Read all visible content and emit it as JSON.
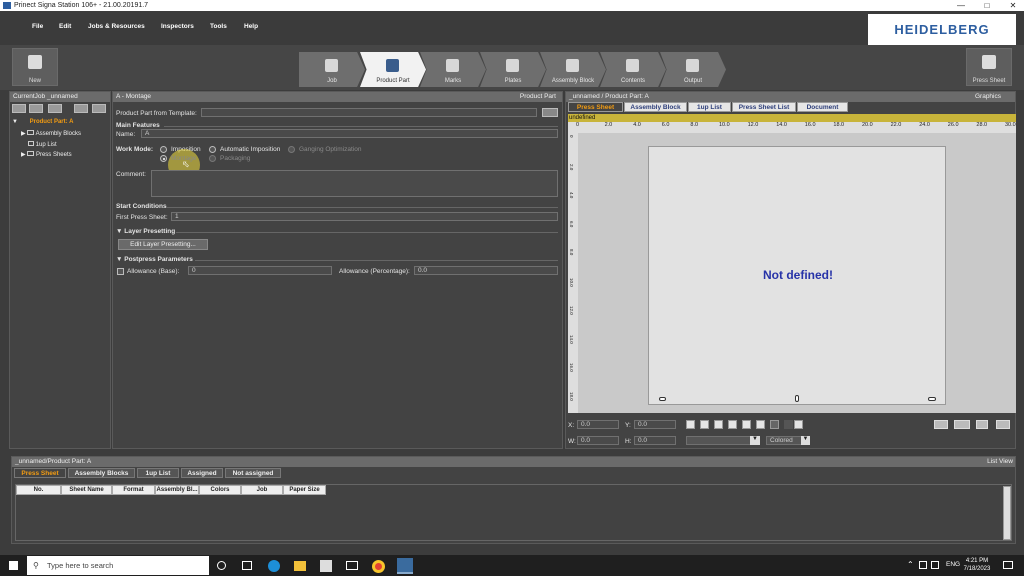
{
  "window": {
    "title": "Prinect Signa Station 106+  -  21.00.20191.7"
  },
  "menu": [
    "File",
    "Edit",
    "Jobs & Resources",
    "Inspectors",
    "Tools",
    "Help"
  ],
  "brand": "HEIDELBERG",
  "toolbar": {
    "new_label": "New",
    "press_sheet_label": "Press Sheet",
    "workflow": [
      "Job",
      "Product Part",
      "Marks",
      "Plates",
      "Assembly Block",
      "Contents",
      "Output"
    ],
    "active_step": "Product Part"
  },
  "left_panel": {
    "title": "CurrentJob _unnamed",
    "tree": {
      "root": "Product Part: A",
      "children": [
        "Assembly Blocks",
        "1up List",
        "Press Sheets"
      ]
    }
  },
  "montage": {
    "title": "A - Montage",
    "title_right": "Product Part",
    "template_label": "Product Part from Template:",
    "main_features": "Main Features",
    "name_label": "Name:",
    "name_value": "A",
    "work_mode_label": "Work Mode:",
    "modes": {
      "imposition": "Imposition",
      "automatic": "Automatic Imposition",
      "ganging": "Ganging Optimization",
      "montage": "Montage",
      "packaging": "Packaging"
    },
    "selected_mode": "Montage",
    "comment_label": "Comment:",
    "start_conditions": "Start Conditions",
    "first_press_sheet_label": "First Press Sheet:",
    "first_press_sheet_value": "1",
    "layer_presetting": "Layer Presetting",
    "edit_layer_button": "Edit Layer Presetting...",
    "postpress": "Postpress Parameters",
    "allowance_base_label": "Allowance (Base):",
    "allowance_base_value": "0",
    "allowance_pct_label": "Allowance (Percentage):",
    "allowance_pct_value": "0.0"
  },
  "graphics": {
    "title": "_unnamed / Product Part: A",
    "title_right": "Graphics",
    "tabs": [
      "Press Sheet",
      "Assembly Block",
      "1up List",
      "Press Sheet List",
      "Document"
    ],
    "active_tab": "Press Sheet",
    "ruler_label": "undefined",
    "ruler_ticks": [
      "0",
      "2.0",
      "4.0",
      "6.0",
      "8.0",
      "10.0",
      "12.0",
      "14.0",
      "16.0",
      "18.0",
      "20.0",
      "22.0",
      "24.0",
      "26.0",
      "28.0",
      "30.0"
    ],
    "vruler_ticks": [
      "0",
      "2.0",
      "4.0",
      "6.0",
      "8.0",
      "10.0",
      "12.0",
      "14.0",
      "16.0",
      "18.0"
    ],
    "message": "Not defined!",
    "x_label": "X:",
    "x_value": "0.0",
    "y_label": "Y:",
    "y_value": "0.0",
    "w_label": "W:",
    "w_value": "0.0",
    "h_label": "H:",
    "h_value": "0.0",
    "color_mode": "Colored"
  },
  "list_view": {
    "title": "_unnamed/Product Part: A",
    "title_right": "List View",
    "tabs": [
      "Press Sheet",
      "Assembly Blocks",
      "1up List",
      "Assigned",
      "Not assigned"
    ],
    "active_tab": "Press Sheet",
    "columns": [
      "No.",
      "Sheet Name",
      "Format",
      "Assembly Bl...",
      "Colors",
      "Job",
      "Paper Size"
    ]
  },
  "taskbar": {
    "search_placeholder": "Type here to search",
    "language": "ENG",
    "time": "4:21 PM",
    "date": "7/18/2023"
  }
}
